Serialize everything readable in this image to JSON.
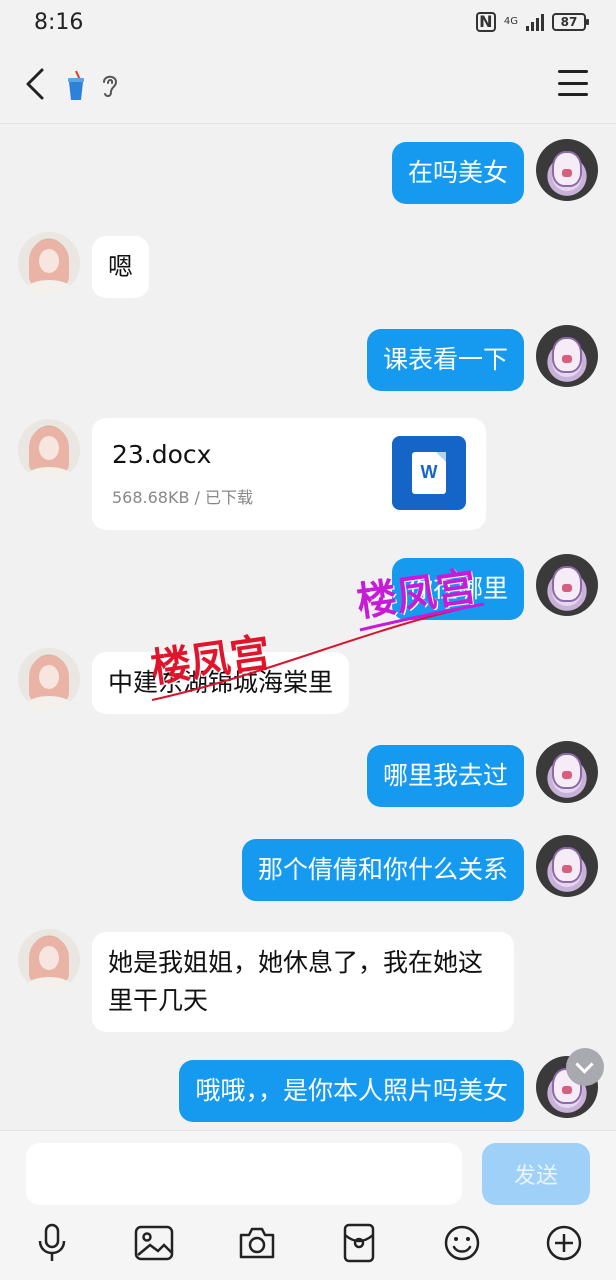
{
  "status_bar": {
    "time": "8:16",
    "nfc": "N",
    "network": "4G",
    "battery": "87"
  },
  "header": {
    "back_icon": "chevron-left-icon",
    "title_icons": [
      "cup-emoji-icon",
      "ear-icon"
    ],
    "menu_icon": "hamburger-menu-icon"
  },
  "messages": [
    {
      "side": "mine",
      "text": "在吗美女"
    },
    {
      "side": "theirs",
      "text": "嗯"
    },
    {
      "side": "mine",
      "text": "课表看一下"
    },
    {
      "side": "theirs",
      "type": "file",
      "file_name": "23.docx",
      "file_meta": "568.68KB / 已下载",
      "file_icon": "word-doc-icon",
      "file_icon_letter": "W"
    },
    {
      "side": "mine",
      "text": "你在哪里"
    },
    {
      "side": "theirs",
      "text": "中建东湖锦城海棠里"
    },
    {
      "side": "mine",
      "text": "哪里我去过"
    },
    {
      "side": "mine",
      "text": "那个倩倩和你什么关系"
    },
    {
      "side": "theirs",
      "text": "她是我姐姐，她休息了，我在她这里干几天"
    },
    {
      "side": "mine",
      "text": "哦哦，，是你本人照片吗美女"
    }
  ],
  "watermark": {
    "text": "楼凤宫",
    "colors": [
      "#c81bd8",
      "#e0152b"
    ]
  },
  "input": {
    "placeholder": "",
    "value": "",
    "send_label": "发送"
  },
  "toolbar": [
    "microphone-icon",
    "image-icon",
    "camera-icon",
    "red-packet-icon",
    "emoji-icon",
    "plus-icon"
  ],
  "colors": {
    "my_bubble": "#169af0",
    "their_bubble": "#ffffff",
    "send_disabled": "#9fd0f7"
  }
}
